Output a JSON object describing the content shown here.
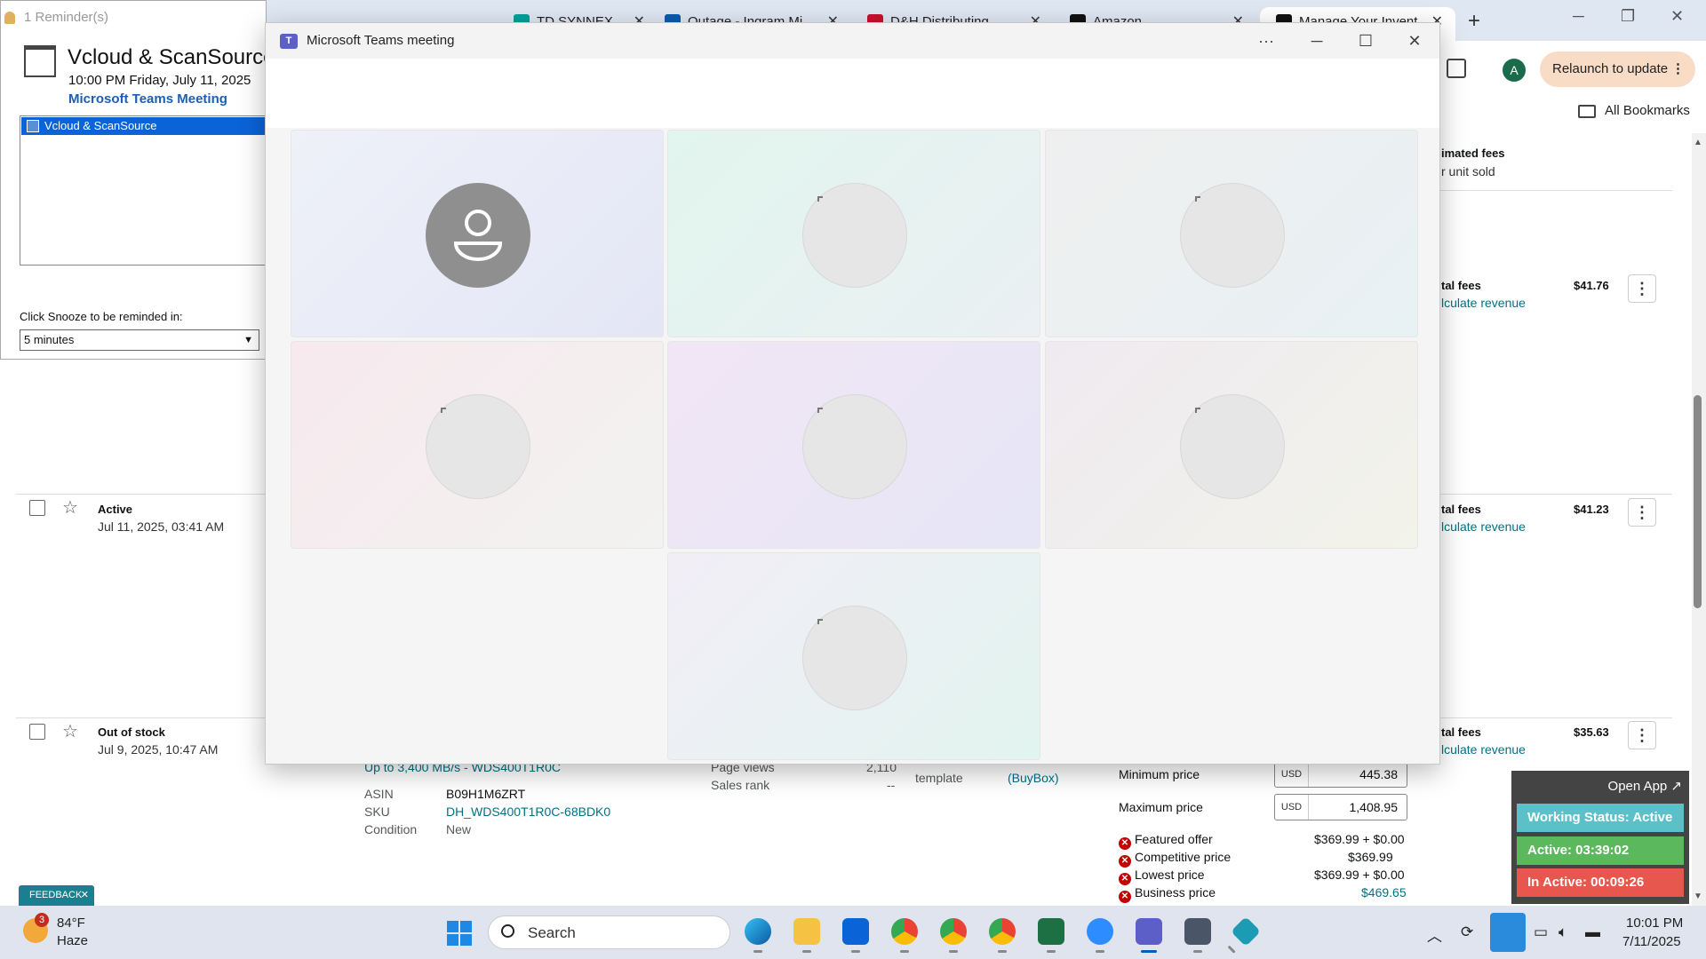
{
  "browser": {
    "tabs": [
      {
        "label": "TD SYNNEX",
        "color": "#00a19a"
      },
      {
        "label": "Outage - Ingram Mi",
        "color": "#0b5cab"
      },
      {
        "label": "D&H Distributing",
        "color": "#c8102e"
      },
      {
        "label": "Amazon",
        "color": "#111111"
      },
      {
        "label": "Manage Your Invent",
        "color": "#111111"
      }
    ],
    "avatar_letter": "A",
    "relaunch_label": "Relaunch to update",
    "bookmarks_label": "All Bookmarks"
  },
  "inventory": {
    "col_header": [
      "imated fees",
      "r unit sold"
    ],
    "rows": [
      {
        "status": "",
        "date": "",
        "fees_title": "tal fees",
        "fees_link": "lculate revenue",
        "fees_value": "$41.76"
      },
      {
        "status": "Active",
        "date": "Jul 11, 2025, 03:41 AM",
        "fees_title": "tal fees",
        "fees_link": "lculate revenue",
        "fees_value": "$41.23"
      },
      {
        "status": "Out of stock",
        "date": "Jul 9, 2025, 10:47 AM",
        "fees_title": "tal fees",
        "fees_link": "lculate revenue",
        "fees_value": "$35.63"
      }
    ],
    "product": {
      "title_tail": "Up to 3,400 MB/s - WDS400T1R0C",
      "asin_label": "ASIN",
      "asin": "B09H1M6ZRT",
      "sku_label": "SKU",
      "sku": "DH_WDS400T1R0C-68BDK0",
      "condition_label": "Condition",
      "condition": "New",
      "page_views_label": "Page views",
      "page_views": "2,110",
      "sales_rank_label": "Sales rank",
      "sales_rank": "--",
      "template_label": "template",
      "buybox": "(BuyBox)"
    },
    "pricing": {
      "min_label": "Minimum price",
      "min_currency": "USD",
      "min_value": "445.38",
      "max_label": "Maximum price",
      "max_currency": "USD",
      "max_value": "1,408.95",
      "featured_label": "Featured offer",
      "featured_value": "$369.99 + $0.00",
      "competitive_label": "Competitive price",
      "competitive_value": "$369.99",
      "lowest_label": "Lowest price",
      "lowest_value": "$369.99 + $0.00",
      "business_label": "Business price",
      "business_value": "$469.65"
    },
    "feedback_label": "FEEDBACK"
  },
  "tracker": {
    "open_app": "Open App ↗",
    "working_status": "Working Status: Active",
    "active": "Active: 03:39:02",
    "inactive": "In Active: 00:09:26",
    "colors": {
      "working": "#5bc0c8",
      "active": "#5cb85c",
      "inactive": "#e8574d"
    }
  },
  "reminder": {
    "window_title": "1 Reminder(s)",
    "subject": "Vcloud & ScanSource",
    "time": "10:00 PM Friday, July 11, 2025",
    "location": "Microsoft Teams Meeting",
    "list_item": "Vcloud & ScanSource",
    "snooze_label": "Click Snooze to be reminded in:",
    "snooze_value": "5 minutes"
  },
  "teams": {
    "window_title": "Microsoft Teams meeting",
    "more_label": "···",
    "participants_count": 7,
    "accent": "#5b5fc7"
  },
  "taskbar": {
    "weather_badge": "3",
    "weather_temp": "84°F",
    "weather_desc": "Haze",
    "search_placeholder": "Search",
    "clock_time": "10:01 PM",
    "clock_date": "7/11/2025"
  }
}
